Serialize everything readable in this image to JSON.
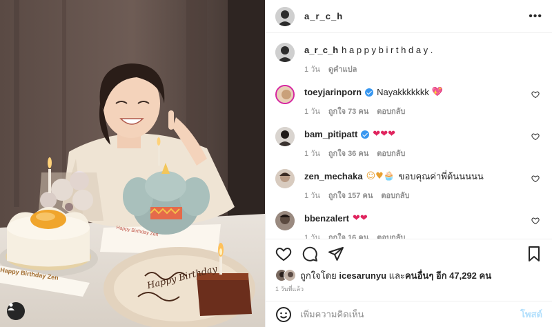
{
  "header": {
    "username": "a_r_c_h",
    "more_icon": "more-horizontal-icon"
  },
  "caption": {
    "username": "a_r_c_h",
    "text": "h a p p y b i r t h d a y .",
    "time": "1 วัน",
    "translate": "ดูคำแปล"
  },
  "comments": [
    {
      "username": "toeyjarinporn",
      "verified": true,
      "text": "Nayakkkkkkk",
      "emoji": "💖",
      "time": "1 วัน",
      "likes": "ถูกใจ 73 คน",
      "reply": "ตอบกลับ",
      "avatar_color": "#c9a07a"
    },
    {
      "username": "bam_pitipatt",
      "verified": true,
      "text": "",
      "emoji": "❤❤❤",
      "time": "1 วัน",
      "likes": "ถูกใจ 36 คน",
      "reply": "ตอบกลับ",
      "avatar_color": "#7a6f64"
    },
    {
      "username": "zen_mechaka",
      "verified": false,
      "text": "ขอบคุณค่าพี่ต้นนนนน",
      "emoji": "☺♥🧁",
      "time": "1 วัน",
      "likes": "ถูกใจ 157 คน",
      "reply": "ตอบกลับ",
      "avatar_color": "#b89a84"
    },
    {
      "username": "bbenzalert",
      "verified": false,
      "text": "",
      "emoji": "❤❤",
      "time": "1 วัน",
      "likes": "ถูกใจ 16 คน",
      "reply": "ตอบกลับ",
      "avatar_color": "#5b4a40"
    }
  ],
  "likes": {
    "prefix": "ถูกใจโดย",
    "user": "icesarunyu",
    "middle": "และ",
    "others": "คนอื่นๆ อีก 47,292 คน"
  },
  "timestamp": "1 วันที่แล้ว",
  "add_comment": {
    "placeholder": "เพิ่มความคิดเห็น",
    "post_label": "โพสต์"
  },
  "photo": {
    "cake_text_1": "Happy Birthday Zen",
    "plate_text": "Happy Birthday",
    "cake_label": "Happy Birthday Zen"
  },
  "colors": {
    "accent": "#0095f6",
    "post_disabled": "#b2dffc",
    "muted": "#8e8e8e",
    "heart": "#ed4956"
  }
}
